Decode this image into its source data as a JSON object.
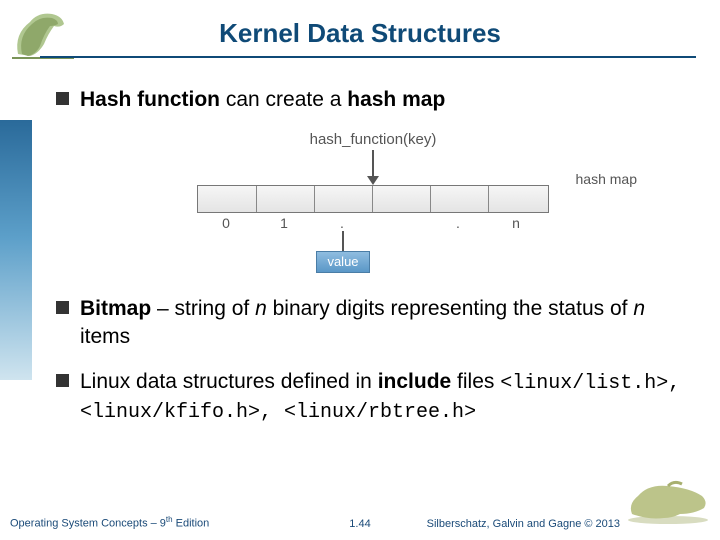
{
  "title": "Kernel Data Structures",
  "bullets": {
    "b1_prefix": "Hash function",
    "b1_mid": " can create a ",
    "b1_suffix": "hash map",
    "b2_prefix": "Bitmap",
    "b2_mid": " – string of ",
    "b2_n1": "n",
    "b2_mid2": " binary digits representing the status of ",
    "b2_n2": "n",
    "b2_end": " items",
    "b3_lead": "Linux data structures defined in ",
    "b3_bold": "include",
    "b3_after": " files ",
    "b3_code": "<linux/list.h>, <linux/kfifo.h>, <linux/rbtree.h>"
  },
  "diagram": {
    "func_label": "hash_function(key)",
    "map_label": "hash map",
    "value_label": "value",
    "idx0": "0",
    "idx1": "1",
    "dot": ".",
    "idxn": "n"
  },
  "footer": {
    "left_a": "Operating System Concepts – 9",
    "left_sup": "th",
    "left_b": " Edition",
    "center": "1.44",
    "right": "Silberschatz, Galvin and Gagne © 2013"
  }
}
